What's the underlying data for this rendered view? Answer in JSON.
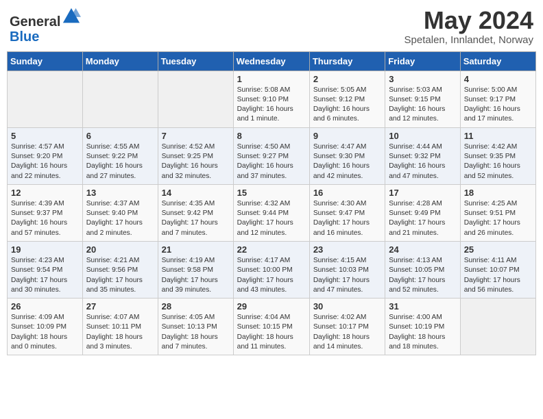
{
  "header": {
    "logo_line1": "General",
    "logo_line2": "Blue",
    "month_title": "May 2024",
    "location": "Spetalen, Innlandet, Norway"
  },
  "weekdays": [
    "Sunday",
    "Monday",
    "Tuesday",
    "Wednesday",
    "Thursday",
    "Friday",
    "Saturday"
  ],
  "weeks": [
    [
      {
        "day": "",
        "text": ""
      },
      {
        "day": "",
        "text": ""
      },
      {
        "day": "",
        "text": ""
      },
      {
        "day": "1",
        "text": "Sunrise: 5:08 AM\nSunset: 9:10 PM\nDaylight: 16 hours\nand 1 minute."
      },
      {
        "day": "2",
        "text": "Sunrise: 5:05 AM\nSunset: 9:12 PM\nDaylight: 16 hours\nand 6 minutes."
      },
      {
        "day": "3",
        "text": "Sunrise: 5:03 AM\nSunset: 9:15 PM\nDaylight: 16 hours\nand 12 minutes."
      },
      {
        "day": "4",
        "text": "Sunrise: 5:00 AM\nSunset: 9:17 PM\nDaylight: 16 hours\nand 17 minutes."
      }
    ],
    [
      {
        "day": "5",
        "text": "Sunrise: 4:57 AM\nSunset: 9:20 PM\nDaylight: 16 hours\nand 22 minutes."
      },
      {
        "day": "6",
        "text": "Sunrise: 4:55 AM\nSunset: 9:22 PM\nDaylight: 16 hours\nand 27 minutes."
      },
      {
        "day": "7",
        "text": "Sunrise: 4:52 AM\nSunset: 9:25 PM\nDaylight: 16 hours\nand 32 minutes."
      },
      {
        "day": "8",
        "text": "Sunrise: 4:50 AM\nSunset: 9:27 PM\nDaylight: 16 hours\nand 37 minutes."
      },
      {
        "day": "9",
        "text": "Sunrise: 4:47 AM\nSunset: 9:30 PM\nDaylight: 16 hours\nand 42 minutes."
      },
      {
        "day": "10",
        "text": "Sunrise: 4:44 AM\nSunset: 9:32 PM\nDaylight: 16 hours\nand 47 minutes."
      },
      {
        "day": "11",
        "text": "Sunrise: 4:42 AM\nSunset: 9:35 PM\nDaylight: 16 hours\nand 52 minutes."
      }
    ],
    [
      {
        "day": "12",
        "text": "Sunrise: 4:39 AM\nSunset: 9:37 PM\nDaylight: 16 hours\nand 57 minutes."
      },
      {
        "day": "13",
        "text": "Sunrise: 4:37 AM\nSunset: 9:40 PM\nDaylight: 17 hours\nand 2 minutes."
      },
      {
        "day": "14",
        "text": "Sunrise: 4:35 AM\nSunset: 9:42 PM\nDaylight: 17 hours\nand 7 minutes."
      },
      {
        "day": "15",
        "text": "Sunrise: 4:32 AM\nSunset: 9:44 PM\nDaylight: 17 hours\nand 12 minutes."
      },
      {
        "day": "16",
        "text": "Sunrise: 4:30 AM\nSunset: 9:47 PM\nDaylight: 17 hours\nand 16 minutes."
      },
      {
        "day": "17",
        "text": "Sunrise: 4:28 AM\nSunset: 9:49 PM\nDaylight: 17 hours\nand 21 minutes."
      },
      {
        "day": "18",
        "text": "Sunrise: 4:25 AM\nSunset: 9:51 PM\nDaylight: 17 hours\nand 26 minutes."
      }
    ],
    [
      {
        "day": "19",
        "text": "Sunrise: 4:23 AM\nSunset: 9:54 PM\nDaylight: 17 hours\nand 30 minutes."
      },
      {
        "day": "20",
        "text": "Sunrise: 4:21 AM\nSunset: 9:56 PM\nDaylight: 17 hours\nand 35 minutes."
      },
      {
        "day": "21",
        "text": "Sunrise: 4:19 AM\nSunset: 9:58 PM\nDaylight: 17 hours\nand 39 minutes."
      },
      {
        "day": "22",
        "text": "Sunrise: 4:17 AM\nSunset: 10:00 PM\nDaylight: 17 hours\nand 43 minutes."
      },
      {
        "day": "23",
        "text": "Sunrise: 4:15 AM\nSunset: 10:03 PM\nDaylight: 17 hours\nand 47 minutes."
      },
      {
        "day": "24",
        "text": "Sunrise: 4:13 AM\nSunset: 10:05 PM\nDaylight: 17 hours\nand 52 minutes."
      },
      {
        "day": "25",
        "text": "Sunrise: 4:11 AM\nSunset: 10:07 PM\nDaylight: 17 hours\nand 56 minutes."
      }
    ],
    [
      {
        "day": "26",
        "text": "Sunrise: 4:09 AM\nSunset: 10:09 PM\nDaylight: 18 hours\nand 0 minutes."
      },
      {
        "day": "27",
        "text": "Sunrise: 4:07 AM\nSunset: 10:11 PM\nDaylight: 18 hours\nand 3 minutes."
      },
      {
        "day": "28",
        "text": "Sunrise: 4:05 AM\nSunset: 10:13 PM\nDaylight: 18 hours\nand 7 minutes."
      },
      {
        "day": "29",
        "text": "Sunrise: 4:04 AM\nSunset: 10:15 PM\nDaylight: 18 hours\nand 11 minutes."
      },
      {
        "day": "30",
        "text": "Sunrise: 4:02 AM\nSunset: 10:17 PM\nDaylight: 18 hours\nand 14 minutes."
      },
      {
        "day": "31",
        "text": "Sunrise: 4:00 AM\nSunset: 10:19 PM\nDaylight: 18 hours\nand 18 minutes."
      },
      {
        "day": "",
        "text": ""
      }
    ]
  ]
}
